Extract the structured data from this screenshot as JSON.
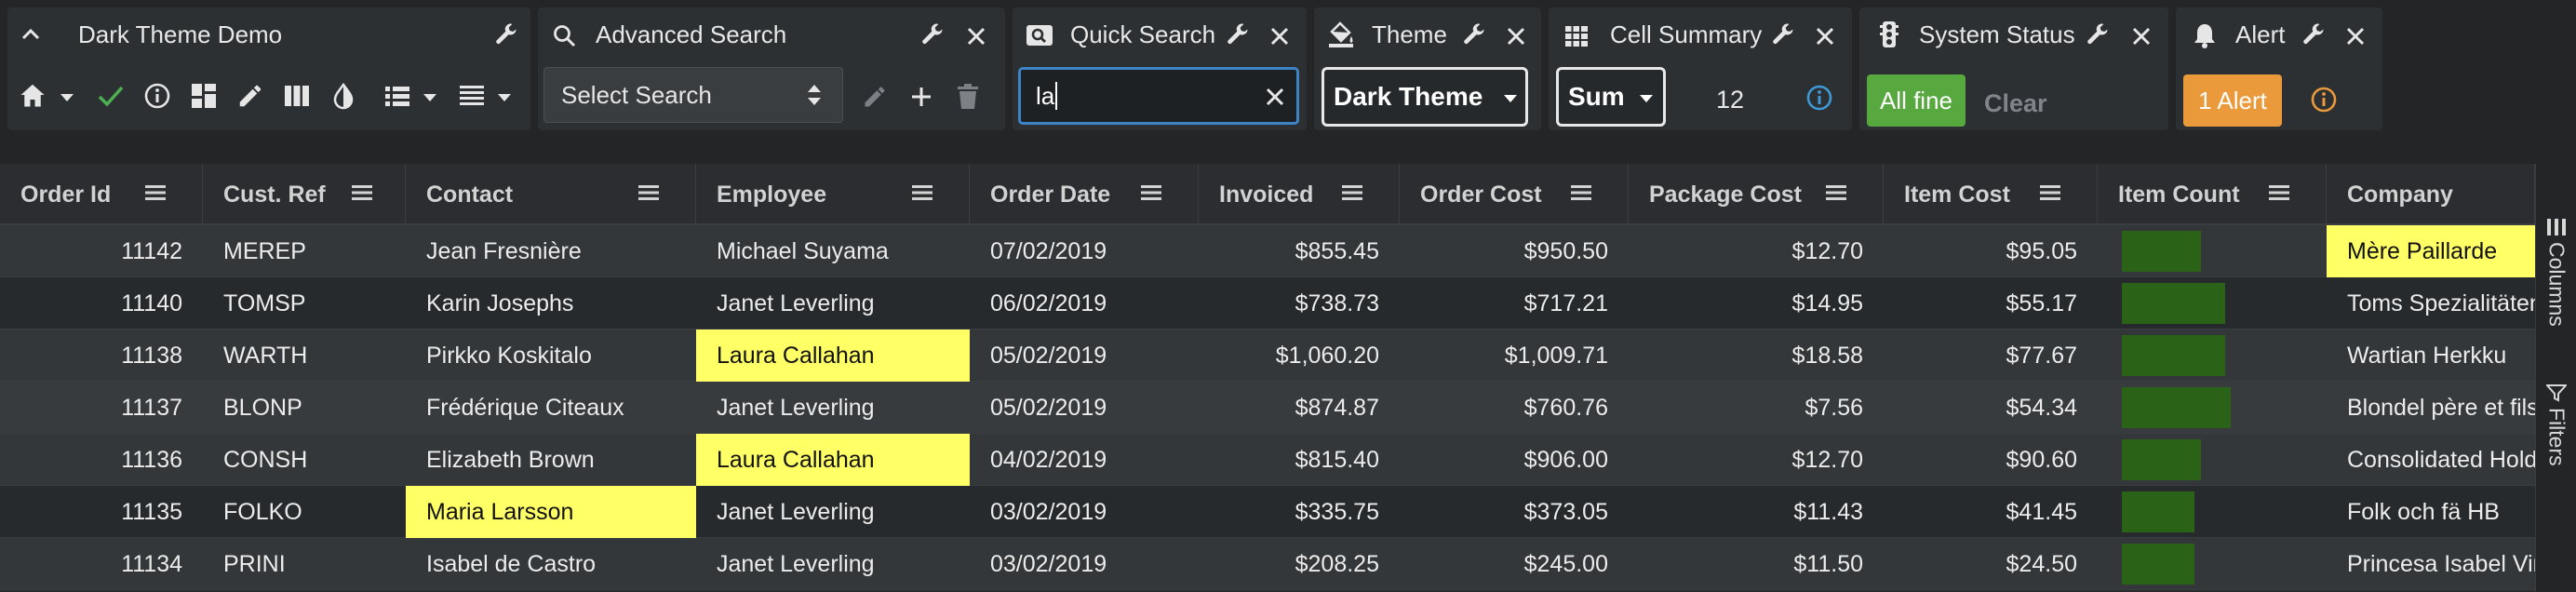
{
  "dashboard": {
    "title": "Dark Theme Demo",
    "toolbars": {
      "advanced_search": {
        "title": "Advanced Search",
        "select_value": "Select Search"
      },
      "quick_search": {
        "title": "Quick Search",
        "input_value": "la"
      },
      "theme": {
        "title": "Theme",
        "select_value": "Dark Theme"
      },
      "cell_summary": {
        "title": "Cell Summary",
        "operation": "Sum",
        "value": "12"
      },
      "system_status": {
        "title": "System Status",
        "status_button": "All fine",
        "clear_button": "Clear"
      },
      "alert": {
        "title": "Alert",
        "alert_button": "1 Alert"
      }
    }
  },
  "grid": {
    "columns": [
      {
        "label": "Order Id"
      },
      {
        "label": "Cust. Ref"
      },
      {
        "label": "Contact"
      },
      {
        "label": "Employee"
      },
      {
        "label": "Order Date"
      },
      {
        "label": "Invoiced"
      },
      {
        "label": "Order Cost"
      },
      {
        "label": "Package Cost"
      },
      {
        "label": "Item Cost"
      },
      {
        "label": "Item Count"
      },
      {
        "label": "Company"
      }
    ],
    "rows": [
      {
        "order_id": "11142",
        "cust_ref": "MEREP",
        "contact": "Jean Fresnière",
        "employee": "Michael Suyama",
        "order_date": "07/02/2019",
        "invoiced": "$855.45",
        "order_cost": "$950.50",
        "package_cost": "$12.70",
        "item_cost": "$95.05",
        "item_count": 0.65,
        "company": "Mère Paillarde",
        "highlight": [
          "company"
        ]
      },
      {
        "order_id": "11140",
        "cust_ref": "TOMSP",
        "contact": "Karin Josephs",
        "employee": "Janet Leverling",
        "order_date": "06/02/2019",
        "invoiced": "$738.73",
        "order_cost": "$717.21",
        "package_cost": "$14.95",
        "item_cost": "$55.17",
        "item_count": 0.85,
        "company": "Toms Spezialitäten",
        "highlight": []
      },
      {
        "order_id": "11138",
        "cust_ref": "WARTH",
        "contact": "Pirkko Koskitalo",
        "employee": "Laura Callahan",
        "order_date": "05/02/2019",
        "invoiced": "$1,060.20",
        "order_cost": "$1,009.71",
        "package_cost": "$18.58",
        "item_cost": "$77.67",
        "item_count": 0.85,
        "company": "Wartian Herkku",
        "highlight": [
          "employee"
        ]
      },
      {
        "order_id": "11137",
        "cust_ref": "BLONP",
        "contact": "Frédérique Citeaux",
        "employee": "Janet Leverling",
        "order_date": "05/02/2019",
        "invoiced": "$874.87",
        "order_cost": "$760.76",
        "package_cost": "$7.56",
        "item_cost": "$54.34",
        "item_count": 0.9,
        "company": "Blondel père et fils",
        "highlight": []
      },
      {
        "order_id": "11136",
        "cust_ref": "CONSH",
        "contact": "Elizabeth Brown",
        "employee": "Laura Callahan",
        "order_date": "04/02/2019",
        "invoiced": "$815.40",
        "order_cost": "$906.00",
        "package_cost": "$12.70",
        "item_cost": "$90.60",
        "item_count": 0.65,
        "company": "Consolidated Holdings",
        "highlight": [
          "employee"
        ]
      },
      {
        "order_id": "11135",
        "cust_ref": "FOLKO",
        "contact": "Maria Larsson",
        "employee": "Janet Leverling",
        "order_date": "03/02/2019",
        "invoiced": "$335.75",
        "order_cost": "$373.05",
        "package_cost": "$11.43",
        "item_cost": "$41.45",
        "item_count": 0.6,
        "company": "Folk och fä HB",
        "highlight": [
          "contact"
        ]
      },
      {
        "order_id": "11134",
        "cust_ref": "PRINI",
        "contact": "Isabel de Castro",
        "employee": "Janet Leverling",
        "order_date": "03/02/2019",
        "invoiced": "$208.25",
        "order_cost": "$245.00",
        "package_cost": "$11.50",
        "item_cost": "$24.50",
        "item_count": 0.6,
        "company": "Princesa Isabel Vinhos",
        "highlight": []
      }
    ]
  },
  "side_bar": {
    "columns_label": "Columns",
    "filters_label": "Filters"
  },
  "colors": {
    "highlight": "#ffff66",
    "accent": "#3d84c6",
    "success": "#56a83f",
    "warning": "#eb9a3b",
    "bar": "#2a6218"
  },
  "icons": [
    "chevron-up-icon",
    "wrench-icon",
    "close-icon",
    "search-icon",
    "home-icon",
    "caret-down-icon",
    "check-icon",
    "info-icon",
    "layout-icon",
    "pencil-icon",
    "columns-icon",
    "contrast-icon",
    "list-icon",
    "align-icon",
    "plus-icon",
    "trash-icon",
    "paint-bucket-icon",
    "grid-icon",
    "traffic-light-icon",
    "bell-icon",
    "menu-icon",
    "filter-icon"
  ]
}
